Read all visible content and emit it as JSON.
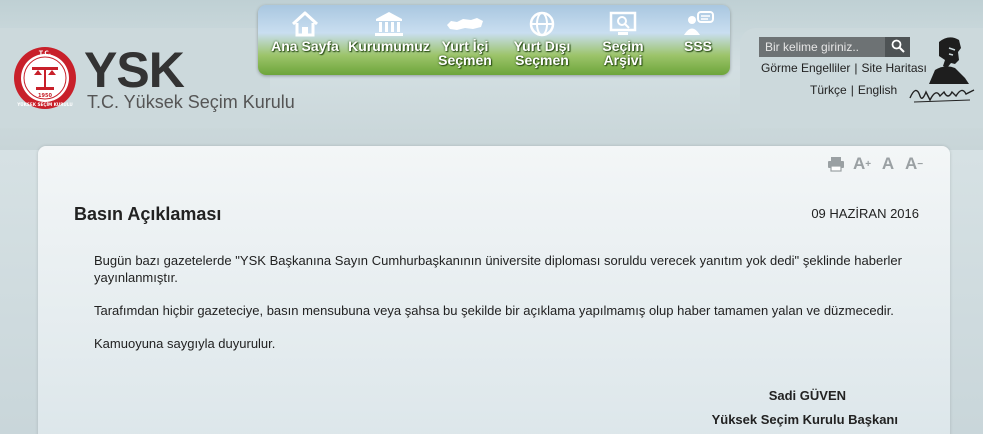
{
  "logo": {
    "name": "YSK",
    "subtitle": "T.C. Yüksek Seçim Kurulu",
    "seal_year": "1950",
    "seal_top": "T.C.",
    "seal_bottom": "YÜKSEK SEÇİM KURULU"
  },
  "nav": {
    "items": [
      {
        "label_line1": "Ana Sayfa",
        "label_line2": "",
        "icon": "home-icon"
      },
      {
        "label_line1": "Kurumumuz",
        "label_line2": "",
        "icon": "institution-icon"
      },
      {
        "label_line1": "Yurt İçi",
        "label_line2": "Seçmen",
        "icon": "turkey-map-icon"
      },
      {
        "label_line1": "Yurt Dışı",
        "label_line2": "Seçmen",
        "icon": "globe-icon"
      },
      {
        "label_line1": "Seçim",
        "label_line2": "Arşivi",
        "icon": "archive-monitor-icon"
      },
      {
        "label_line1": "SSS",
        "label_line2": "",
        "icon": "faq-person-icon"
      }
    ]
  },
  "header": {
    "search_placeholder": "Bir kelime giriniz..",
    "links": [
      "Görme Engelliler",
      "Site Haritası"
    ],
    "languages": [
      "Türkçe",
      "English"
    ],
    "separator": "|"
  },
  "article": {
    "title": "Basın Açıklaması",
    "date": "09 HAZİRAN 2016",
    "paragraphs": [
      "Bugün bazı gazetelerde \"YSK Başkanına Sayın Cumhurbaşkanının üniversite diploması soruldu verecek yanıtım yok dedi\" şeklinde haberler yayınlanmıştır.",
      "Tarafımdan hiçbir gazeteciye, basın mensubuna veya şahsa bu şekilde bir açıklama yapılmamış olup haber tamamen yalan ve düzmecedir.",
      "Kamuoyuna saygıyla duyurulur."
    ],
    "signatory_name": "Sadi GÜVEN",
    "signatory_title": "Yüksek Seçim Kurulu Başkanı"
  },
  "tools": {
    "font_increase": "A",
    "font_normal": "A",
    "font_decrease": "A"
  },
  "colors": {
    "nav_green": "#6da53a",
    "search_bg": "#6d7274",
    "seal_red": "#c8202a"
  }
}
